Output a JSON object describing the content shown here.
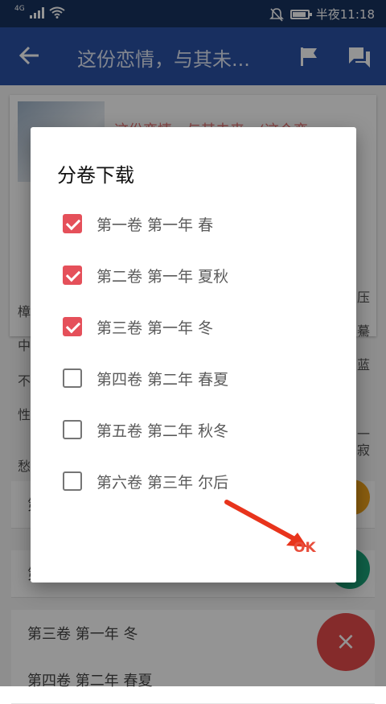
{
  "status_bar": {
    "network": "4G",
    "time": "半夜11:18",
    "battery_level": 0.9
  },
  "app_bar": {
    "title": "这份恋情，与其未..."
  },
  "background": {
    "book_title": "这份恋情，与其未来，(这个恋",
    "left_chars": [
      "樟",
      "中",
      "不",
      "性",
      "愁"
    ],
    "right_chars": [
      "压",
      "驀",
      "蓝",
      "一",
      "寂"
    ],
    "row_texts": [
      "第",
      "第",
      "第三卷 第一年 冬",
      "第四卷 第二年 春夏"
    ]
  },
  "dialog": {
    "title": "分卷下载",
    "options": [
      {
        "label": "第一卷 第一年 春",
        "checked": true
      },
      {
        "label": "第二卷 第一年 夏秋",
        "checked": true
      },
      {
        "label": "第三卷 第一年 冬",
        "checked": true
      },
      {
        "label": "第四卷 第二年 春夏",
        "checked": false
      },
      {
        "label": "第五卷 第二年 秋冬",
        "checked": false
      },
      {
        "label": "第六卷 第三年 尔后",
        "checked": false
      }
    ],
    "ok_label": "OK"
  },
  "fab_close_symbol": "×",
  "colors": {
    "status_bar": "#17325f",
    "app_bar": "#2a52a6",
    "accent": "#e5505a",
    "ok_text": "#e84e3c",
    "arrow": "#e8341c"
  },
  "icons": [
    "back-arrow-icon",
    "flag-icon",
    "chat-icon",
    "mute-icon",
    "wifi-icon",
    "signal-icon",
    "battery-icon",
    "close-icon"
  ]
}
